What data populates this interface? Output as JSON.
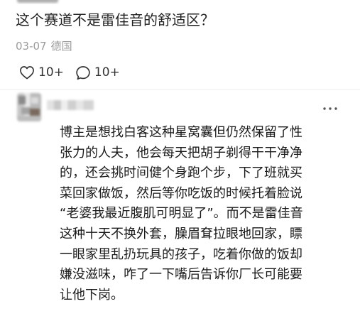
{
  "post": {
    "question": "这个赛道不是雷佳音的舒适区？",
    "date": "03-07",
    "location": "德国"
  },
  "actions": {
    "like": {
      "icon": "heart-icon",
      "count": "10+"
    },
    "comment": {
      "icon": "comment-bubble-icon",
      "count": "10+"
    }
  },
  "comment": {
    "more_icon": "more-icon",
    "lines": [
      "博主是想找白客这种星窝囊但仍然保留了性",
      "张力的人夫，他会每天把胡子剃得干干净净",
      "的，还会挑时间健个身跑个步，下了班就买",
      "菜回家做饭，然后等你吃饭的时候托着脸说",
      "“老婆我最近腹肌可明显了”。而不是雷佳音",
      "这种十天不换外套，臊眉耷拉眼地回家，瞟",
      "一眼家里乱扔玩具的孩子，吃着你做的饭却",
      "嫌没滋味，咋了一下嘴后告诉你厂长可能要",
      "让他下岗。"
    ]
  },
  "colors": {
    "text": "#1a1a1a",
    "meta": "#9b9b9b",
    "icon": "#333333"
  }
}
